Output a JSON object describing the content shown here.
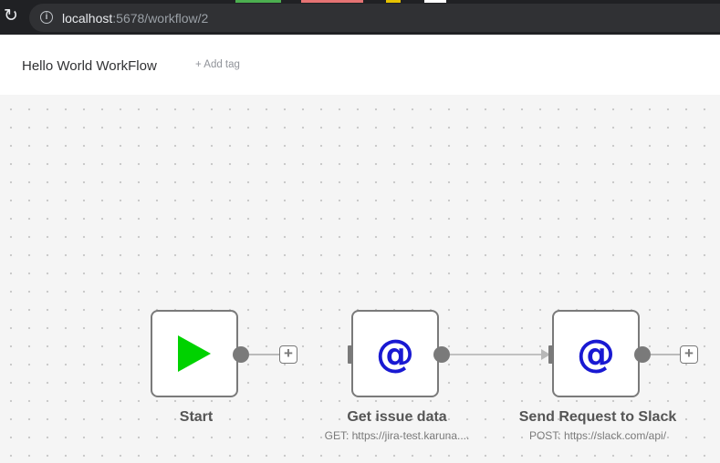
{
  "browser": {
    "url_host": "localhost",
    "url_path": ":5678/workflow/2",
    "icons": {
      "reload": "reload-icon",
      "info": "info-icon"
    },
    "info_glyph": "i",
    "reload_glyph": "↻"
  },
  "header": {
    "workflow_name": "Hello World WorkFlow",
    "add_tag_label": "+ Add tag"
  },
  "nodes": {
    "start": {
      "title": "Start",
      "icon": "play-icon",
      "color": "#00d200"
    },
    "get_issue": {
      "title": "Get issue data",
      "subtitle": "GET: https://jira-test.karuna....",
      "icon": "at-icon",
      "glyph": "@",
      "color": "#1919d2"
    },
    "send_slack": {
      "title": "Send Request to Slack",
      "subtitle": "POST: https://slack.com/api/",
      "icon": "at-icon",
      "glyph": "@",
      "color": "#1919d2"
    }
  },
  "plus_glyph": "+",
  "colors": {
    "node_border": "#7a7a7a",
    "canvas_bg": "#f5f5f5",
    "browser_bg": "#202124"
  }
}
